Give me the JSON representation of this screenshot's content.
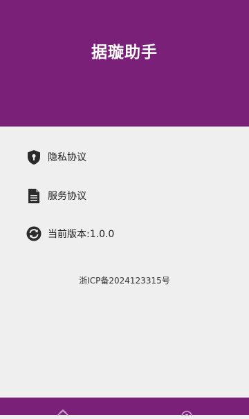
{
  "header": {
    "title": "据璇助手"
  },
  "menu": {
    "items": [
      {
        "label": "隐私协议",
        "icon": "shield-lock-icon"
      },
      {
        "label": "服务协议",
        "icon": "document-icon"
      },
      {
        "label": "当前版本:1.0.0",
        "icon": "refresh-icon"
      }
    ]
  },
  "footer": {
    "icp": "浙ICP备2024123315号"
  },
  "bottom_nav": {
    "items": [
      {
        "icon": "home-icon"
      },
      {
        "icon": "settings-icon"
      }
    ]
  },
  "colors": {
    "primary": "#7a2079",
    "background": "#efefef",
    "icon": "#2b2b2b"
  }
}
